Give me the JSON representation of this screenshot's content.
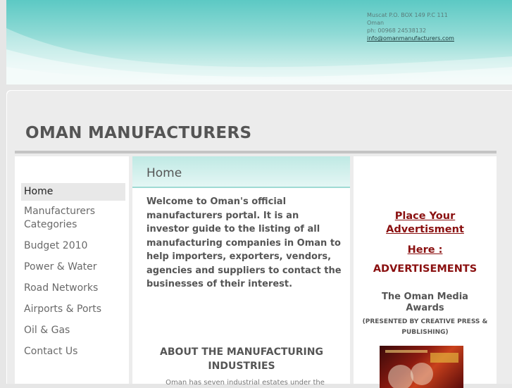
{
  "header": {
    "address": "Muscat P.O. BOX 149 P.C 111",
    "country": "Oman",
    "phone": "ph: 00968 24538132",
    "email": "info@omanmanufacturers.com"
  },
  "site": {
    "title": "OMAN MANUFACTURERS"
  },
  "nav": {
    "items": [
      {
        "label": "Home",
        "active": true
      },
      {
        "label": "Manufacturers Categories"
      },
      {
        "label": "Budget 2010"
      },
      {
        "label": "Power & Water"
      },
      {
        "label": "Road Networks"
      },
      {
        "label": "Airports & Ports"
      },
      {
        "label": "Oil & Gas"
      },
      {
        "label": "Contact Us"
      }
    ]
  },
  "main": {
    "heading": "Home",
    "intro": "Welcome to Oman's official manufacturers portal. It is an investor guide to the listing of all manufacturing companies in Oman to help importers, exporters, vendors, agencies and suppliers to contact the businesses of their interest.",
    "about_heading": "ABOUT THE MANUFACTURING INDUSTRIES",
    "about_text_partial": "Oman has seven industrial estates under the"
  },
  "sidebar": {
    "ad_link_1": "Place Your",
    "ad_link_2": "Advertisment",
    "ad_link_3": "Here :",
    "ads_heading": "ADVERTISEMENTS",
    "awards_title": "The Oman Media Awards",
    "awards_presented": "(PRESENTED BY CREATIVE PRESS & PUBLISHING)"
  },
  "colors": {
    "banner_teal": "#5cc9c4",
    "ad_red": "#8a1010",
    "title_gray": "#555555"
  }
}
